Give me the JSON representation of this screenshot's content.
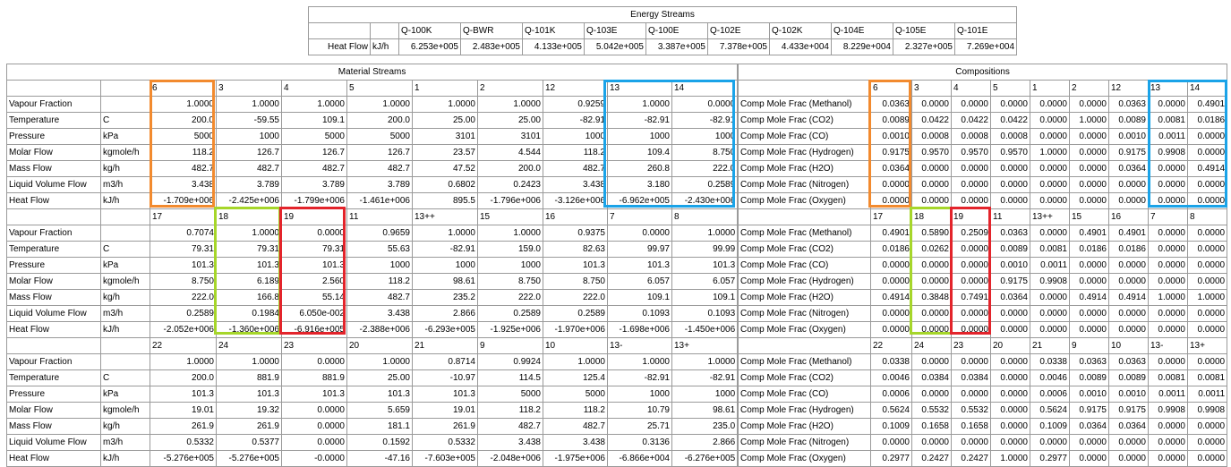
{
  "energy": {
    "title": "Energy Streams",
    "row_label": "Heat Flow",
    "unit": "kJ/h",
    "streams": [
      "Q-100K",
      "Q-BWR",
      "Q-101K",
      "Q-103E",
      "Q-100E",
      "Q-102E",
      "Q-102K",
      "Q-104E",
      "Q-105E",
      "Q-101E"
    ],
    "values": [
      "6.253e+005",
      "2.483e+005",
      "4.133e+005",
      "5.042e+005",
      "3.387e+005",
      "7.378e+005",
      "4.433e+004",
      "8.229e+004",
      "2.327e+005",
      "7.269e+004"
    ]
  },
  "material": {
    "title": "Material Streams",
    "rows": [
      {
        "label": "Vapour Fraction",
        "unit": ""
      },
      {
        "label": "Temperature",
        "unit": "C"
      },
      {
        "label": "Pressure",
        "unit": "kPa"
      },
      {
        "label": "Molar Flow",
        "unit": "kgmole/h"
      },
      {
        "label": "Mass Flow",
        "unit": "kg/h"
      },
      {
        "label": "Liquid Volume Flow",
        "unit": "m3/h"
      },
      {
        "label": "Heat Flow",
        "unit": "kJ/h"
      }
    ],
    "blocks": [
      {
        "streams": [
          "6",
          "3",
          "4",
          "5",
          "1",
          "2",
          "12",
          "13",
          "14"
        ],
        "values": [
          [
            "1.0000",
            "1.0000",
            "1.0000",
            "1.0000",
            "1.0000",
            "1.0000",
            "0.9259",
            "1.0000",
            "0.0000"
          ],
          [
            "200.0",
            "-59.55",
            "109.1",
            "200.0",
            "25.00",
            "25.00",
            "-82.91",
            "-82.91",
            "-82.91"
          ],
          [
            "5000",
            "1000",
            "5000",
            "5000",
            "3101",
            "3101",
            "1000",
            "1000",
            "1000"
          ],
          [
            "118.2",
            "126.7",
            "126.7",
            "126.7",
            "23.57",
            "4.544",
            "118.2",
            "109.4",
            "8.750"
          ],
          [
            "482.7",
            "482.7",
            "482.7",
            "482.7",
            "47.52",
            "200.0",
            "482.7",
            "260.8",
            "222.0"
          ],
          [
            "3.438",
            "3.789",
            "3.789",
            "3.789",
            "0.6802",
            "0.2423",
            "3.438",
            "3.180",
            "0.2589"
          ],
          [
            "-1.709e+006",
            "-2.425e+006",
            "-1.799e+006",
            "-1.461e+006",
            "895.5",
            "-1.796e+006",
            "-3.126e+006",
            "-6.962e+005",
            "-2.430e+006"
          ]
        ]
      },
      {
        "streams": [
          "17",
          "18",
          "19",
          "11",
          "13++",
          "15",
          "16",
          "7",
          "8"
        ],
        "values": [
          [
            "0.7074",
            "1.0000",
            "0.0000",
            "0.9659",
            "1.0000",
            "1.0000",
            "0.9375",
            "0.0000",
            "1.0000"
          ],
          [
            "79.31",
            "79.31",
            "79.31",
            "55.63",
            "-82.91",
            "159.0",
            "82.63",
            "99.97",
            "99.99"
          ],
          [
            "101.3",
            "101.3",
            "101.3",
            "1000",
            "1000",
            "1000",
            "101.3",
            "101.3",
            "101.3"
          ],
          [
            "8.750",
            "6.189",
            "2.560",
            "118.2",
            "98.61",
            "8.750",
            "8.750",
            "6.057",
            "6.057"
          ],
          [
            "222.0",
            "166.8",
            "55.14",
            "482.7",
            "235.2",
            "222.0",
            "222.0",
            "109.1",
            "109.1"
          ],
          [
            "0.2589",
            "0.1984",
            "6.050e-002",
            "3.438",
            "2.866",
            "0.2589",
            "0.2589",
            "0.1093",
            "0.1093"
          ],
          [
            "-2.052e+006",
            "-1.360e+006",
            "-6.916e+005",
            "-2.388e+006",
            "-6.293e+005",
            "-1.925e+006",
            "-1.970e+006",
            "-1.698e+006",
            "-1.450e+006"
          ]
        ]
      },
      {
        "streams": [
          "22",
          "24",
          "23",
          "20",
          "21",
          "9",
          "10",
          "13-",
          "13+"
        ],
        "values": [
          [
            "1.0000",
            "1.0000",
            "0.0000",
            "1.0000",
            "0.8714",
            "0.9924",
            "1.0000",
            "1.0000",
            "1.0000"
          ],
          [
            "200.0",
            "881.9",
            "881.9",
            "25.00",
            "-10.97",
            "114.5",
            "125.4",
            "-82.91",
            "-82.91"
          ],
          [
            "101.3",
            "101.3",
            "101.3",
            "101.3",
            "101.3",
            "5000",
            "5000",
            "1000",
            "1000"
          ],
          [
            "19.01",
            "19.32",
            "0.0000",
            "5.659",
            "19.01",
            "118.2",
            "118.2",
            "10.79",
            "98.61"
          ],
          [
            "261.9",
            "261.9",
            "0.0000",
            "181.1",
            "261.9",
            "482.7",
            "482.7",
            "25.71",
            "235.0"
          ],
          [
            "0.5332",
            "0.5377",
            "0.0000",
            "0.1592",
            "0.5332",
            "3.438",
            "3.438",
            "0.3136",
            "2.866"
          ],
          [
            "-5.276e+005",
            "-5.276e+005",
            "-0.0000",
            "-47.16",
            "-7.603e+005",
            "-2.048e+006",
            "-1.975e+006",
            "-6.866e+004",
            "-6.276e+005"
          ]
        ]
      }
    ]
  },
  "compositions": {
    "title": "Compositions",
    "rows": [
      "Comp Mole Frac (Methanol)",
      "Comp Mole Frac (CO2)",
      "Comp Mole Frac (CO)",
      "Comp Mole Frac (Hydrogen)",
      "Comp Mole Frac (H2O)",
      "Comp Mole Frac (Nitrogen)",
      "Comp Mole Frac (Oxygen)"
    ],
    "blocks": [
      {
        "streams": [
          "6",
          "3",
          "4",
          "5",
          "1",
          "2",
          "12",
          "13",
          "14"
        ],
        "values": [
          [
            "0.0363",
            "0.0000",
            "0.0000",
            "0.0000",
            "0.0000",
            "0.0000",
            "0.0363",
            "0.0000",
            "0.4901"
          ],
          [
            "0.0089",
            "0.0422",
            "0.0422",
            "0.0422",
            "0.0000",
            "1.0000",
            "0.0089",
            "0.0081",
            "0.0186"
          ],
          [
            "0.0010",
            "0.0008",
            "0.0008",
            "0.0008",
            "0.0000",
            "0.0000",
            "0.0010",
            "0.0011",
            "0.0000"
          ],
          [
            "0.9175",
            "0.9570",
            "0.9570",
            "0.9570",
            "1.0000",
            "0.0000",
            "0.9175",
            "0.9908",
            "0.0000"
          ],
          [
            "0.0364",
            "0.0000",
            "0.0000",
            "0.0000",
            "0.0000",
            "0.0000",
            "0.0364",
            "0.0000",
            "0.4914"
          ],
          [
            "0.0000",
            "0.0000",
            "0.0000",
            "0.0000",
            "0.0000",
            "0.0000",
            "0.0000",
            "0.0000",
            "0.0000"
          ],
          [
            "0.0000",
            "0.0000",
            "0.0000",
            "0.0000",
            "0.0000",
            "0.0000",
            "0.0000",
            "0.0000",
            "0.0000"
          ]
        ]
      },
      {
        "streams": [
          "17",
          "18",
          "19",
          "11",
          "13++",
          "15",
          "16",
          "7",
          "8"
        ],
        "values": [
          [
            "0.4901",
            "0.5890",
            "0.2509",
            "0.0363",
            "0.0000",
            "0.4901",
            "0.4901",
            "0.0000",
            "0.0000"
          ],
          [
            "0.0186",
            "0.0262",
            "0.0000",
            "0.0089",
            "0.0081",
            "0.0186",
            "0.0186",
            "0.0000",
            "0.0000"
          ],
          [
            "0.0000",
            "0.0000",
            "0.0000",
            "0.0010",
            "0.0011",
            "0.0000",
            "0.0000",
            "0.0000",
            "0.0000"
          ],
          [
            "0.0000",
            "0.0000",
            "0.0000",
            "0.9175",
            "0.9908",
            "0.0000",
            "0.0000",
            "0.0000",
            "0.0000"
          ],
          [
            "0.4914",
            "0.3848",
            "0.7491",
            "0.0364",
            "0.0000",
            "0.4914",
            "0.4914",
            "1.0000",
            "1.0000"
          ],
          [
            "0.0000",
            "0.0000",
            "0.0000",
            "0.0000",
            "0.0000",
            "0.0000",
            "0.0000",
            "0.0000",
            "0.0000"
          ],
          [
            "0.0000",
            "0.0000",
            "0.0000",
            "0.0000",
            "0.0000",
            "0.0000",
            "0.0000",
            "0.0000",
            "0.0000"
          ]
        ]
      },
      {
        "streams": [
          "22",
          "24",
          "23",
          "20",
          "21",
          "9",
          "10",
          "13-",
          "13+"
        ],
        "values": [
          [
            "0.0338",
            "0.0000",
            "0.0000",
            "0.0000",
            "0.0338",
            "0.0363",
            "0.0363",
            "0.0000",
            "0.0000"
          ],
          [
            "0.0046",
            "0.0384",
            "0.0384",
            "0.0000",
            "0.0046",
            "0.0089",
            "0.0089",
            "0.0081",
            "0.0081"
          ],
          [
            "0.0006",
            "0.0000",
            "0.0000",
            "0.0000",
            "0.0006",
            "0.0010",
            "0.0010",
            "0.0011",
            "0.0011"
          ],
          [
            "0.5624",
            "0.5532",
            "0.5532",
            "0.0000",
            "0.5624",
            "0.9175",
            "0.9175",
            "0.9908",
            "0.9908"
          ],
          [
            "0.1009",
            "0.1658",
            "0.1658",
            "0.0000",
            "0.1009",
            "0.0364",
            "0.0364",
            "0.0000",
            "0.0000"
          ],
          [
            "0.0000",
            "0.0000",
            "0.0000",
            "0.0000",
            "0.0000",
            "0.0000",
            "0.0000",
            "0.0000",
            "0.0000"
          ],
          [
            "0.2977",
            "0.2427",
            "0.2427",
            "1.0000",
            "0.2977",
            "0.0000",
            "0.0000",
            "0.0000",
            "0.0000"
          ]
        ]
      }
    ]
  },
  "highlight_colors": {
    "orange": "#F28A2E",
    "blue": "#1AA3E8",
    "green": "#A6D62A",
    "red": "#E3242B"
  }
}
